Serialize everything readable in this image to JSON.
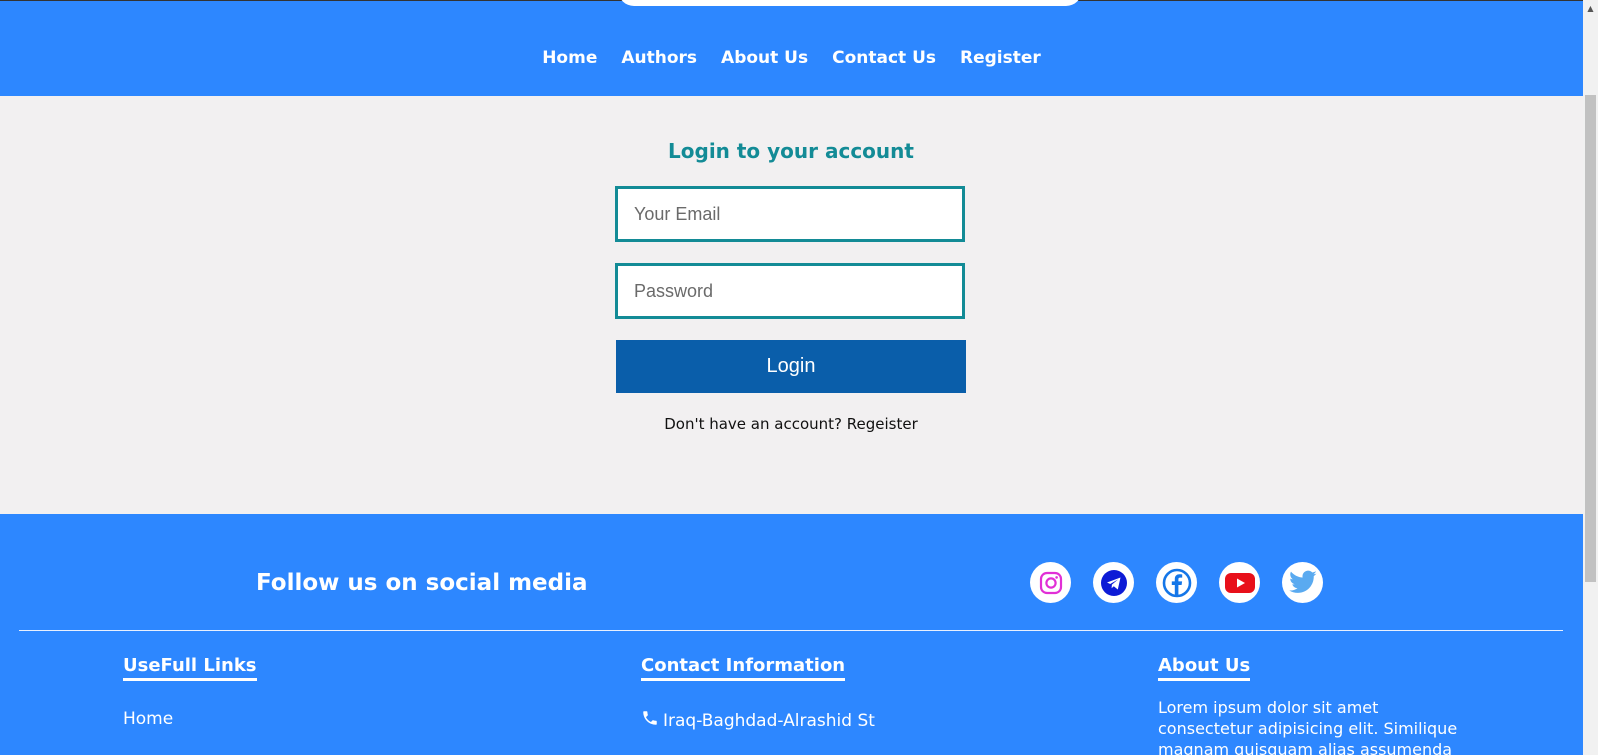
{
  "nav": {
    "items": [
      "Home",
      "Authors",
      "About Us",
      "Contact Us",
      "Register"
    ]
  },
  "login": {
    "title": "Login to your account",
    "email_placeholder": "Your Email",
    "email_value": "",
    "password_placeholder": "Password",
    "password_value": "",
    "button_label": "Login",
    "register_prompt": "Don't have an account? ",
    "register_link": "Regeister"
  },
  "footer": {
    "follow_title": "Follow us on social media",
    "social_icons": [
      "instagram-icon",
      "telegram-icon",
      "facebook-icon",
      "youtube-icon",
      "twitter-icon"
    ],
    "useful_links": {
      "title": "UseFull Links",
      "items": [
        "Home"
      ]
    },
    "contact": {
      "title": "Contact Information",
      "address": "Iraq-Baghdad-Alrashid St"
    },
    "about": {
      "title": "About Us",
      "text": "Lorem ipsum dolor sit amet consectetur adipisicing elit. Similique magnam quisquam alias assumenda"
    }
  },
  "colors": {
    "header_blue": "#2d87ff",
    "teal": "#138b96",
    "button_blue": "#0a5eaa",
    "page_bg": "#f2f0f1"
  }
}
